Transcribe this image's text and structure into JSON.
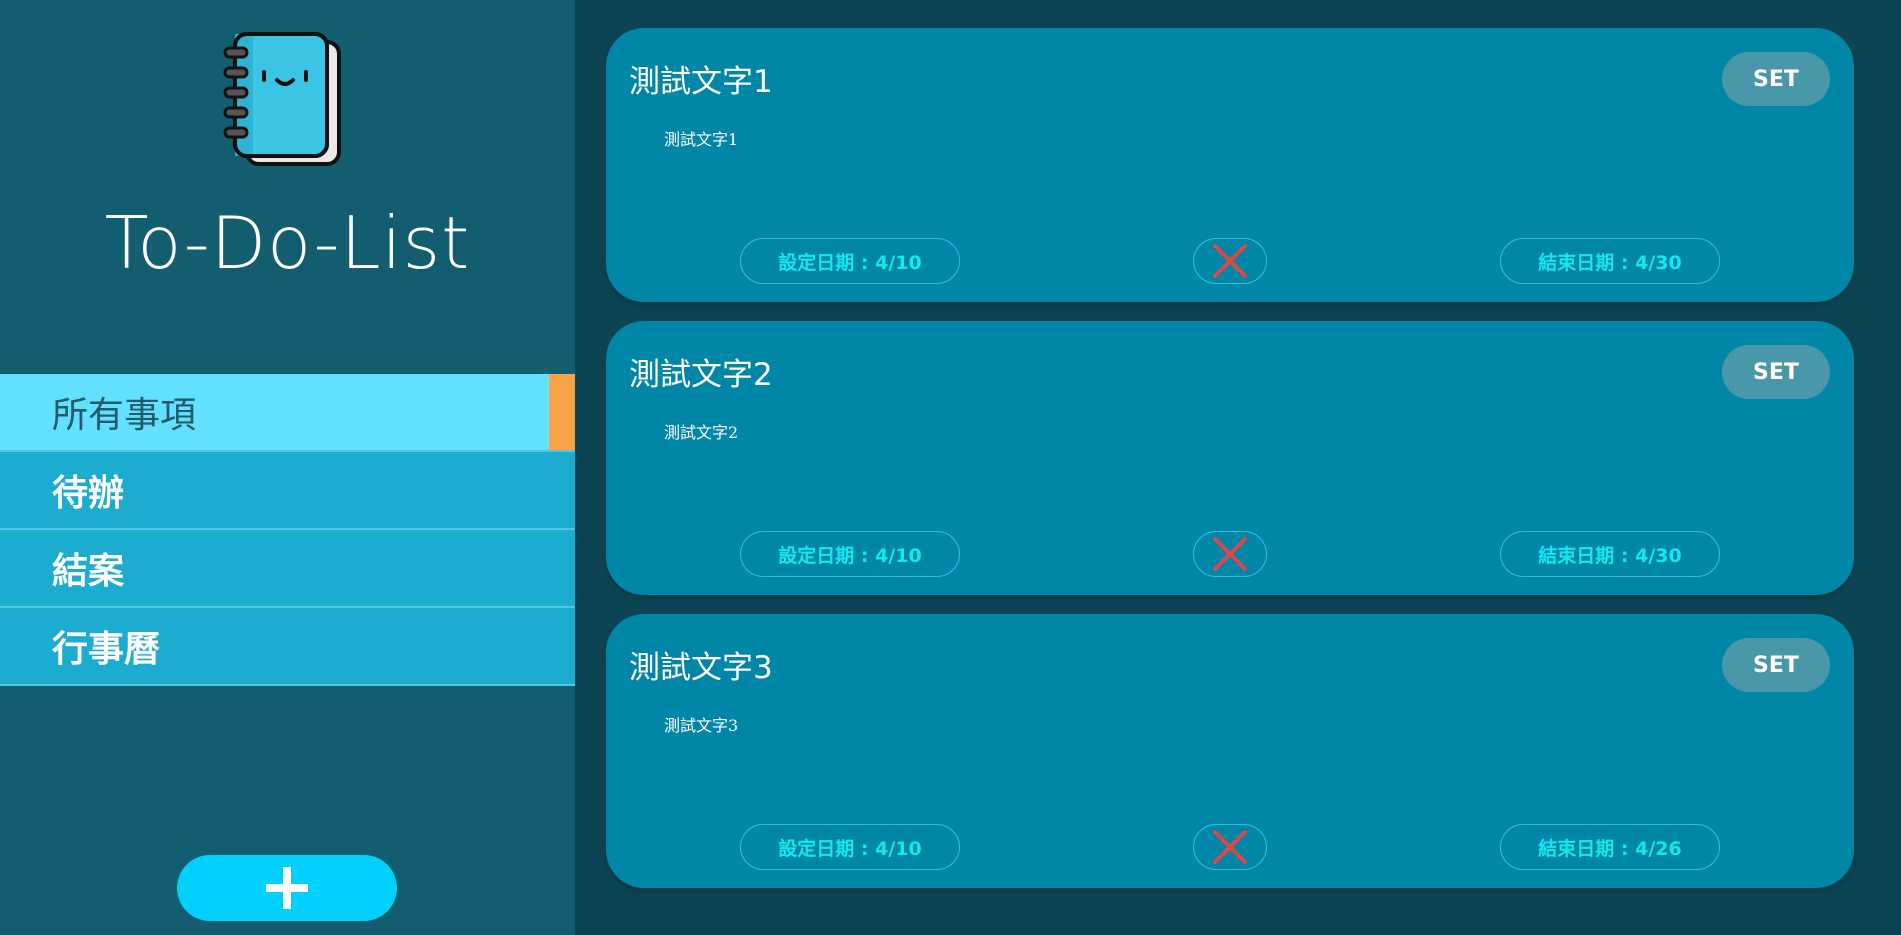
{
  "app": {
    "title": "To-Do-List",
    "logo_icon": "notebook-icon"
  },
  "sidebar": {
    "items": [
      {
        "label": "所有事項",
        "active": true
      },
      {
        "label": "待辦",
        "active": false
      },
      {
        "label": "結案",
        "active": false
      },
      {
        "label": "行事曆",
        "active": false
      }
    ],
    "add_button_icon": "plus-icon"
  },
  "tasks": [
    {
      "title": "測試文字1",
      "description": "測試文字1",
      "set_label": "SET",
      "start_date": "設定日期 : 4/10",
      "end_date": "結束日期 : 4/30",
      "delete_icon": "close-icon"
    },
    {
      "title": "測試文字2",
      "description": "測試文字2",
      "set_label": "SET",
      "start_date": "設定日期 : 4/10",
      "end_date": "結束日期 : 4/30",
      "delete_icon": "close-icon"
    },
    {
      "title": "測試文字3",
      "description": "測試文字3",
      "set_label": "SET",
      "start_date": "設定日期 : 4/10",
      "end_date": "結束日期 : 4/26",
      "delete_icon": "close-icon"
    }
  ],
  "colors": {
    "background": "#0d4453",
    "sidebar": "#135d71",
    "nav_item": "#1caccf",
    "nav_active": "#62e1fe",
    "accent": "#f7a346",
    "card": "#0086a6",
    "pill_text": "#12e8f0",
    "delete": "#e04848",
    "add_button": "#00d0fb"
  }
}
